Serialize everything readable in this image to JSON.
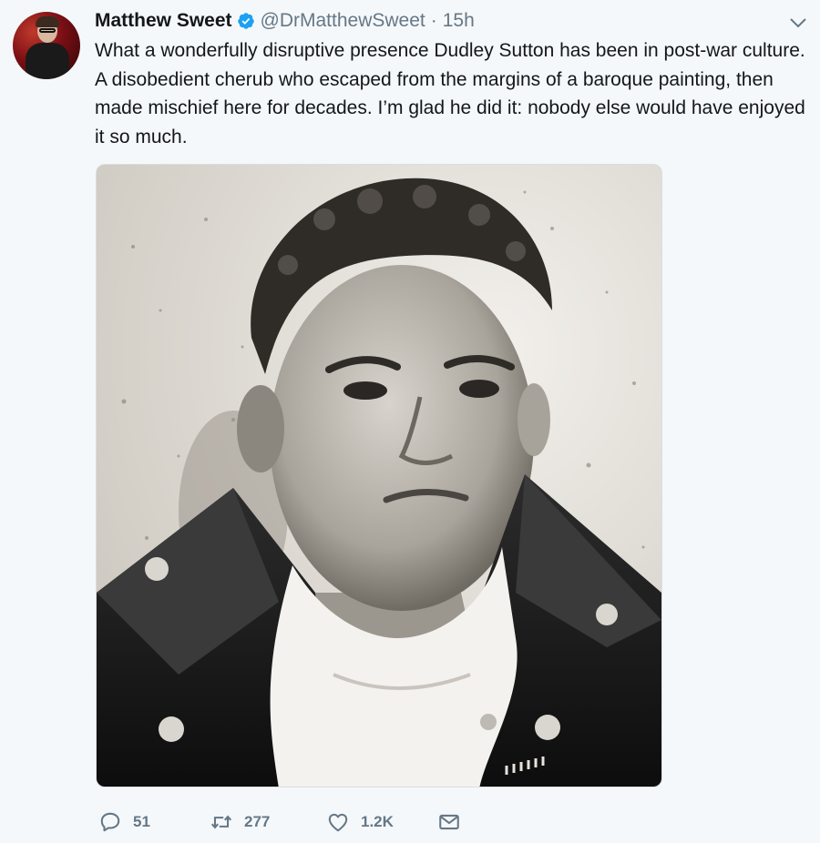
{
  "tweet": {
    "author": {
      "display_name": "Matthew Sweet",
      "handle": "@DrMatthewSweet",
      "verified": true
    },
    "separator": "·",
    "time": "15h",
    "text": "What a wonderfully disruptive presence Dudley Sutton has been in post-war culture. A disobedient cherub who escaped from the margins of a baroque painting, then made mischief here for decades. I’m glad he did it: nobody else would have enjoyed it so much."
  },
  "actions": {
    "replies": "51",
    "retweets": "277",
    "likes": "1.2K"
  },
  "colors": {
    "verified": "#1da1f2",
    "muted": "#657786",
    "background": "#f5f8fa"
  },
  "icons": {
    "menu": "chevron-down-icon",
    "verified": "verified-badge-icon",
    "reply": "reply-icon",
    "retweet": "retweet-icon",
    "like": "heart-icon",
    "dm": "envelope-icon"
  }
}
